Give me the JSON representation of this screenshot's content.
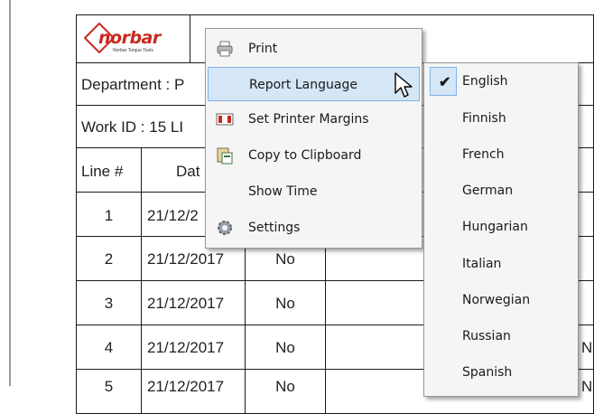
{
  "logo": {
    "word": "norbar",
    "tagline": "Norbar Torque Tools"
  },
  "report": {
    "department": "Department : P",
    "work_id": "Work ID : 15 LI",
    "headers": {
      "line": "Line #",
      "date": "Dat"
    },
    "rows": [
      {
        "line": "1",
        "date": "21/12/2",
        "val": ""
      },
      {
        "line": "2",
        "date": "21/12/2017",
        "val": "No"
      },
      {
        "line": "3",
        "date": "21/12/2017",
        "val": "No"
      },
      {
        "line": "4",
        "date": "21/12/2017",
        "val": "No",
        "extra": "N"
      },
      {
        "line": "5",
        "date": "21/12/2017",
        "val": "No",
        "extra": "N"
      }
    ]
  },
  "context_menu": {
    "items": [
      {
        "label": "Print",
        "icon": "printer-icon"
      },
      {
        "label": "Report Language",
        "icon": "",
        "highlighted": true,
        "has_submenu": true
      },
      {
        "label": "Set Printer Margins",
        "icon": "margins-icon"
      },
      {
        "label": "Copy to Clipboard",
        "icon": "clipboard-icon"
      },
      {
        "label": "Show Time",
        "icon": ""
      },
      {
        "label": "Settings",
        "icon": "gear-icon"
      }
    ]
  },
  "language_menu": {
    "selected": "English",
    "items": [
      "English",
      "Finnish",
      "French",
      "German",
      "Hungarian",
      "Italian",
      "Norwegian",
      "Russian",
      "Spanish"
    ]
  },
  "colors": {
    "highlight": "#d5e6f7",
    "highlight_border": "#7eb4ea",
    "brand_red": "#c8281e"
  }
}
